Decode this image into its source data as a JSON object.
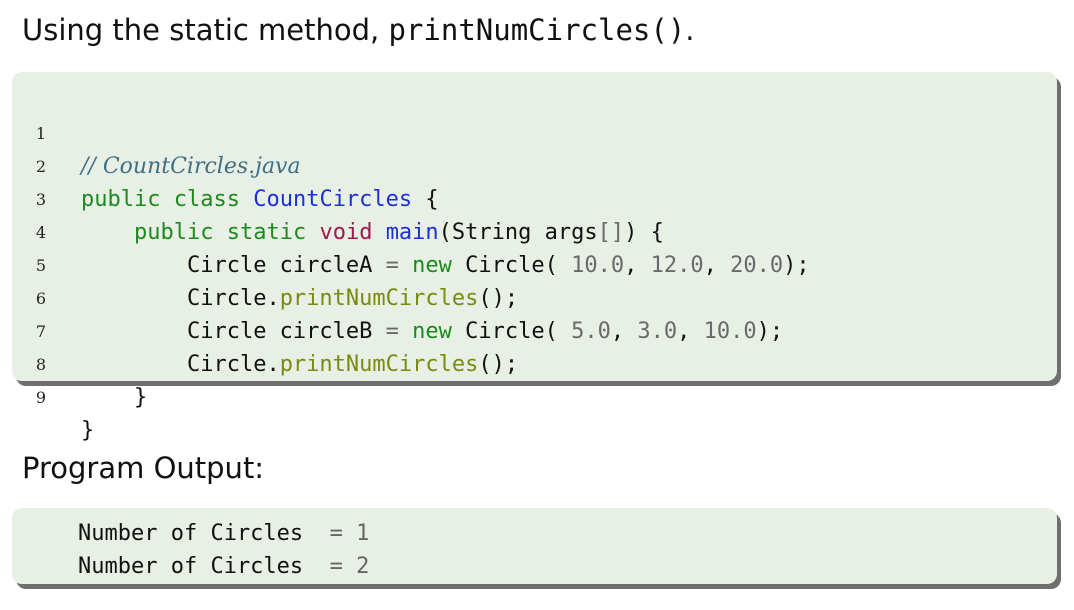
{
  "heading": {
    "prefix": "Using the static method, ",
    "method": "printNumCircles()",
    "suffix": "."
  },
  "code": {
    "line_numbers": [
      "1",
      "2",
      "3",
      "4",
      "5",
      "6",
      "7",
      "8",
      "9"
    ],
    "l1": {
      "comment": "// CountCircles.java"
    },
    "l2": {
      "kw1": "public",
      "kw2": "class",
      "name": "CountCircles",
      "brace": "{"
    },
    "l3": {
      "kw1": "public",
      "kw2": "static",
      "kw3": "void",
      "fn": "main",
      "rest": "(String args",
      "br": "[]",
      "end": ") {"
    },
    "l4": {
      "a": "Circle circleA ",
      "eq": "=",
      "kw": "new",
      "b": " Circle( ",
      "n1": "10.0",
      "c1": ", ",
      "n2": "12.0",
      "c2": ", ",
      "n3": "20.0",
      "end": ");"
    },
    "l5": {
      "a": "Circle.",
      "meth": "printNumCircles",
      "end": "();"
    },
    "l6": {
      "a": "Circle circleB ",
      "eq": "=",
      "kw": "new",
      "b": " Circle( ",
      "n1": "5.0",
      "c1": ", ",
      "n2": "3.0",
      "c2": ", ",
      "n3": "10.0",
      "end": ");"
    },
    "l7": {
      "a": "Circle.",
      "meth": "printNumCircles",
      "end": "();"
    },
    "l8": {
      "brace": "}"
    },
    "l9": {
      "brace": "}"
    }
  },
  "output_heading": "Program Output:",
  "output": [
    {
      "label": "Number of Circles",
      "eq": "= ",
      "value": "1"
    },
    {
      "label": "Number of Circles",
      "eq": "= ",
      "value": "2"
    }
  ],
  "colors": {
    "box_bg": "#e8f0e6",
    "keyword": "#1c8a1c",
    "type_keyword": "#9b1a4a",
    "class_name": "#1b2fd6",
    "method": "#7a8a0f",
    "number": "#6a6a6a",
    "comment": "#3e6f84"
  }
}
